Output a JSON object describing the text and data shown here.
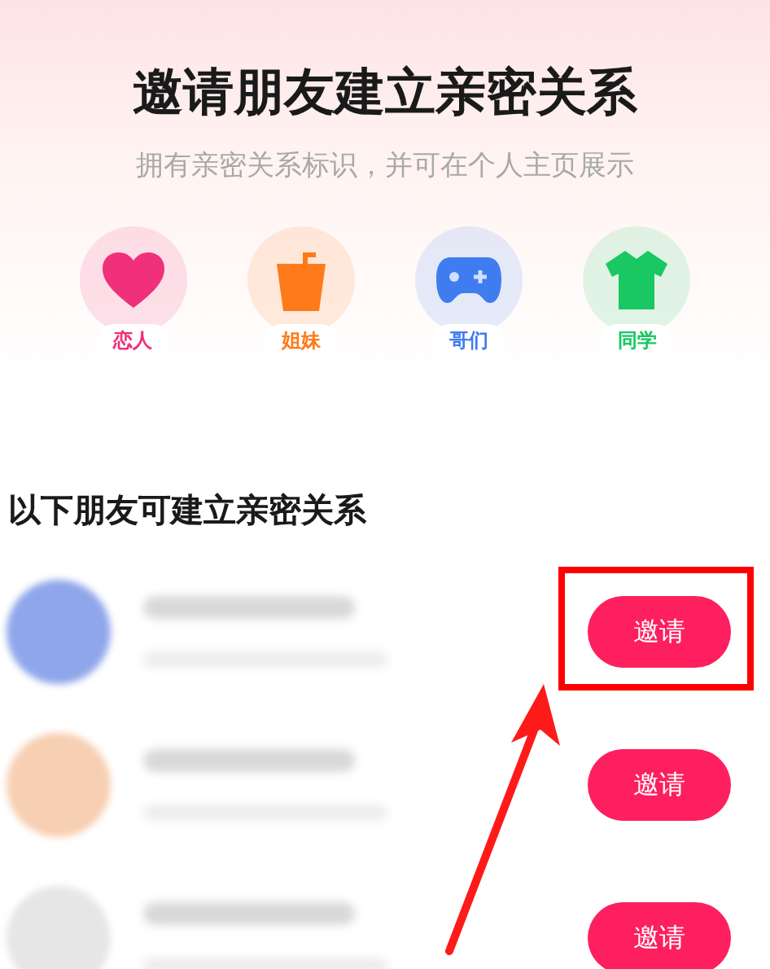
{
  "header": {
    "title": "邀请朋友建立亲密关系",
    "subtitle": "拥有亲密关系标识，并可在个人主页展示"
  },
  "relation_types": [
    {
      "kind": "heart",
      "label": "恋人",
      "color": "#f0307a"
    },
    {
      "kind": "cup",
      "label": "姐妹",
      "color": "#ff7a1a"
    },
    {
      "kind": "gamepad",
      "label": "哥们",
      "color": "#3f7cf0"
    },
    {
      "kind": "shirt",
      "label": "同学",
      "color": "#19c863"
    }
  ],
  "friends_section": {
    "title": "以下朋友可建立亲密关系"
  },
  "friends": [
    {
      "color": "#8fa6ea",
      "button": "邀请",
      "highlighted": true
    },
    {
      "color": "#f7cfb2",
      "button": "邀请",
      "highlighted": false
    },
    {
      "color": "#e6e6e6",
      "button": "邀请",
      "highlighted": false
    }
  ]
}
